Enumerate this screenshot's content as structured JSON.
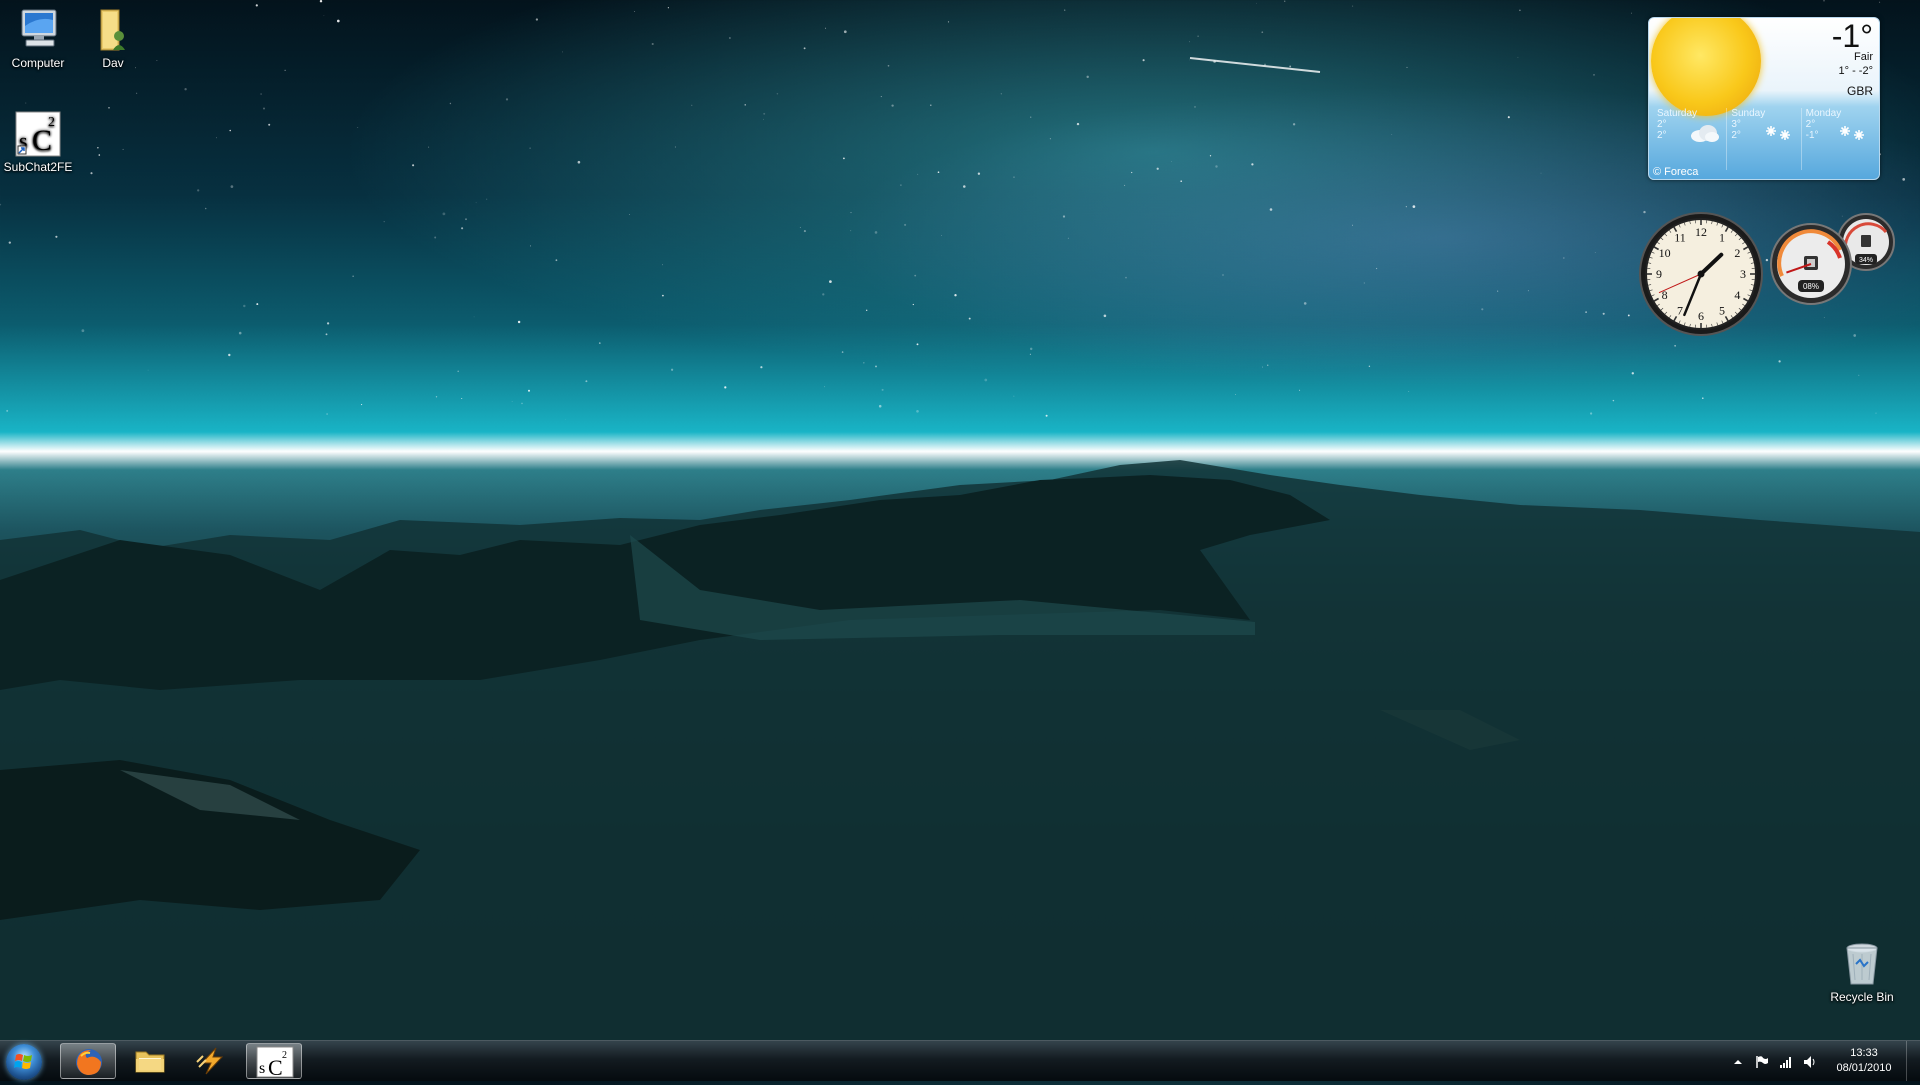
{
  "desktop": {
    "icons": [
      {
        "label": "Computer",
        "icon": "computer-icon"
      },
      {
        "label": "Dav",
        "icon": "user-folder-icon"
      },
      {
        "label": "SubChat2FE",
        "icon": "subchat-shortcut-icon"
      }
    ],
    "recycle_bin": {
      "label": "Recycle Bin",
      "icon": "recycle-bin-icon"
    }
  },
  "weather": {
    "temperature": "-1°",
    "condition": "Fair",
    "range": "1° - -2°",
    "location": "GBR",
    "forecast": [
      {
        "day": "Saturday",
        "high": "2°",
        "low": "2°",
        "icon": "cloud-icon"
      },
      {
        "day": "Sunday",
        "high": "3°",
        "low": "2°",
        "icon": "snow-icon"
      },
      {
        "day": "Monday",
        "high": "2°",
        "low": "-1°",
        "icon": "snow-icon"
      }
    ],
    "credit": "© Foreca"
  },
  "clock": {
    "hour": 1,
    "minute": 33,
    "second": 41
  },
  "cpu_meter": {
    "cpu": "08%",
    "memory": "34%",
    "cpu_value": 0.08,
    "memory_value": 0.34
  },
  "taskbar": {
    "start_icon": "windows-start-icon",
    "pinned": [
      {
        "name": "firefox",
        "icon": "firefox-icon",
        "active": true
      },
      {
        "name": "explorer",
        "icon": "folder-icon",
        "active": false
      },
      {
        "name": "winamp",
        "icon": "winamp-icon",
        "active": false
      },
      {
        "name": "subchat",
        "icon": "subchat-icon",
        "active": true
      }
    ],
    "tray": {
      "time": "13:33",
      "date": "08/01/2010"
    }
  },
  "colors": {
    "sky_accent": "#19b4c6",
    "taskbar": "#0e161b",
    "weather_sun": "#f9c81a"
  }
}
